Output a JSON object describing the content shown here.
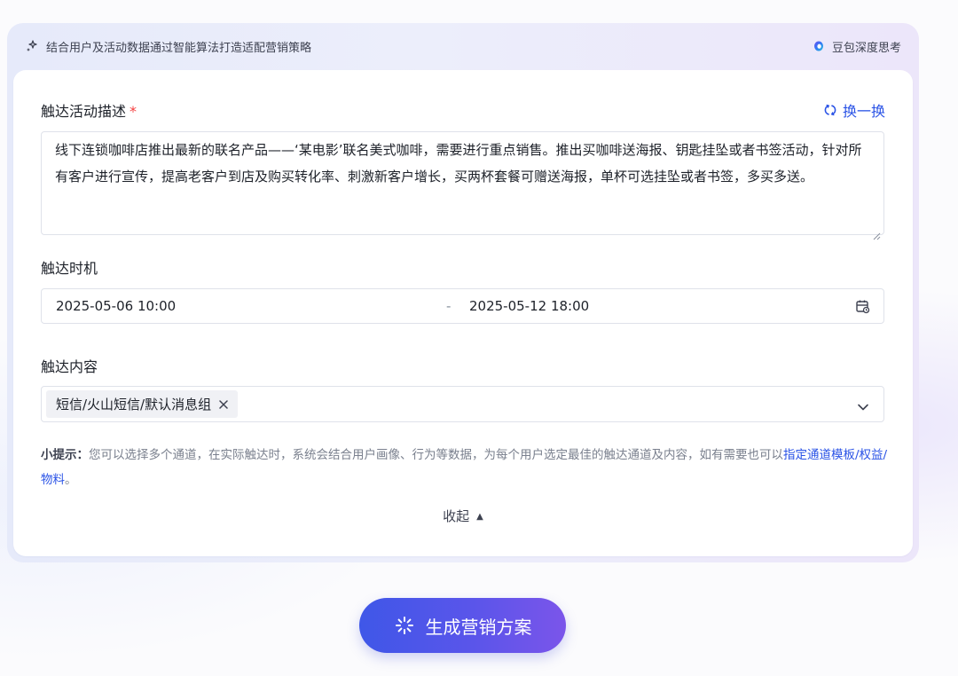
{
  "topbar": {
    "tip_icon": "sparkle-icon",
    "tip_text": "结合用户及活动数据通过智能算法打造适配营销策略",
    "model_icon": "doubao-logo-icon",
    "model_label": "豆包深度思考"
  },
  "form": {
    "description": {
      "label": "触达活动描述",
      "required_mark": "*",
      "swap_icon": "refresh-icon",
      "swap_label": "换一换",
      "value": "线下连锁咖啡店推出最新的联名产品——‘某电影’联名美式咖啡，需要进行重点销售。推出买咖啡送海报、钥匙挂坠或者书签活动，针对所有客户进行宣传，提高老客户到店及购买转化率、刺激新客户增长，买两杯套餐可赠送海报，单杯可选挂坠或者书签，多买多送。"
    },
    "timing": {
      "label": "触达时机",
      "start": "2025-05-06 10:00",
      "separator": "-",
      "end": "2025-05-12 18:00",
      "calendar_icon": "calendar-icon"
    },
    "content": {
      "label": "触达内容",
      "tags": [
        "短信/火山短信/默认消息组"
      ],
      "tag_close_icon": "close-icon",
      "dropdown_icon": "chevron-down-icon"
    },
    "hint": {
      "bold": "小提示：",
      "text": "您可以选择多个通道，在实际触达时，系统会结合用户画像、行为等数据，为每个用户选定最佳的触达通道及内容，如有需要也可以",
      "link": "指定通道模板/权益/物料",
      "tail": "。"
    },
    "collapse_label": "收起",
    "collapse_icon": "triangle-up-icon"
  },
  "generate_button": {
    "icon": "loading-sparkle-icon",
    "label": "生成营销方案"
  },
  "colors": {
    "accent": "#2a53e6",
    "required": "#f53f3f",
    "button_start": "#3f57e8",
    "button_end": "#7b55ea"
  }
}
